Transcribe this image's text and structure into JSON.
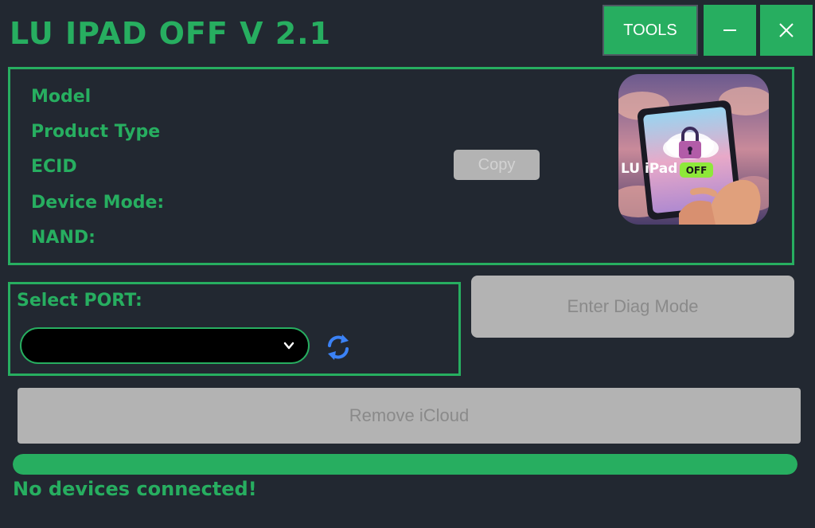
{
  "app": {
    "title": "LU IPAD OFF V 2.1"
  },
  "titlebar": {
    "tools_label": "TOOLS",
    "minimize_icon": "minimize-icon",
    "close_icon": "close-icon"
  },
  "device_info": {
    "fields": [
      {
        "label": "Model",
        "value": ""
      },
      {
        "label": "Product Type",
        "value": ""
      },
      {
        "label": "ECID",
        "value": ""
      },
      {
        "label": "Device Mode:",
        "value": ""
      },
      {
        "label": "NAND:",
        "value": ""
      }
    ],
    "copy_label": "Copy"
  },
  "logo": {
    "text": "LU iPad",
    "badge": "OFF"
  },
  "port": {
    "label": "Select PORT:",
    "selected": "",
    "refresh_icon": "refresh-icon"
  },
  "actions": {
    "diag_label": "Enter Diag Mode",
    "remove_label": "Remove iCloud"
  },
  "progress": {
    "value": 1.0
  },
  "status": {
    "text": "No devices connected!"
  },
  "colors": {
    "accent": "#27ae60",
    "background": "#222831",
    "disabled_button": "#b3b3b3",
    "refresh_blue": "#3b82f6"
  }
}
